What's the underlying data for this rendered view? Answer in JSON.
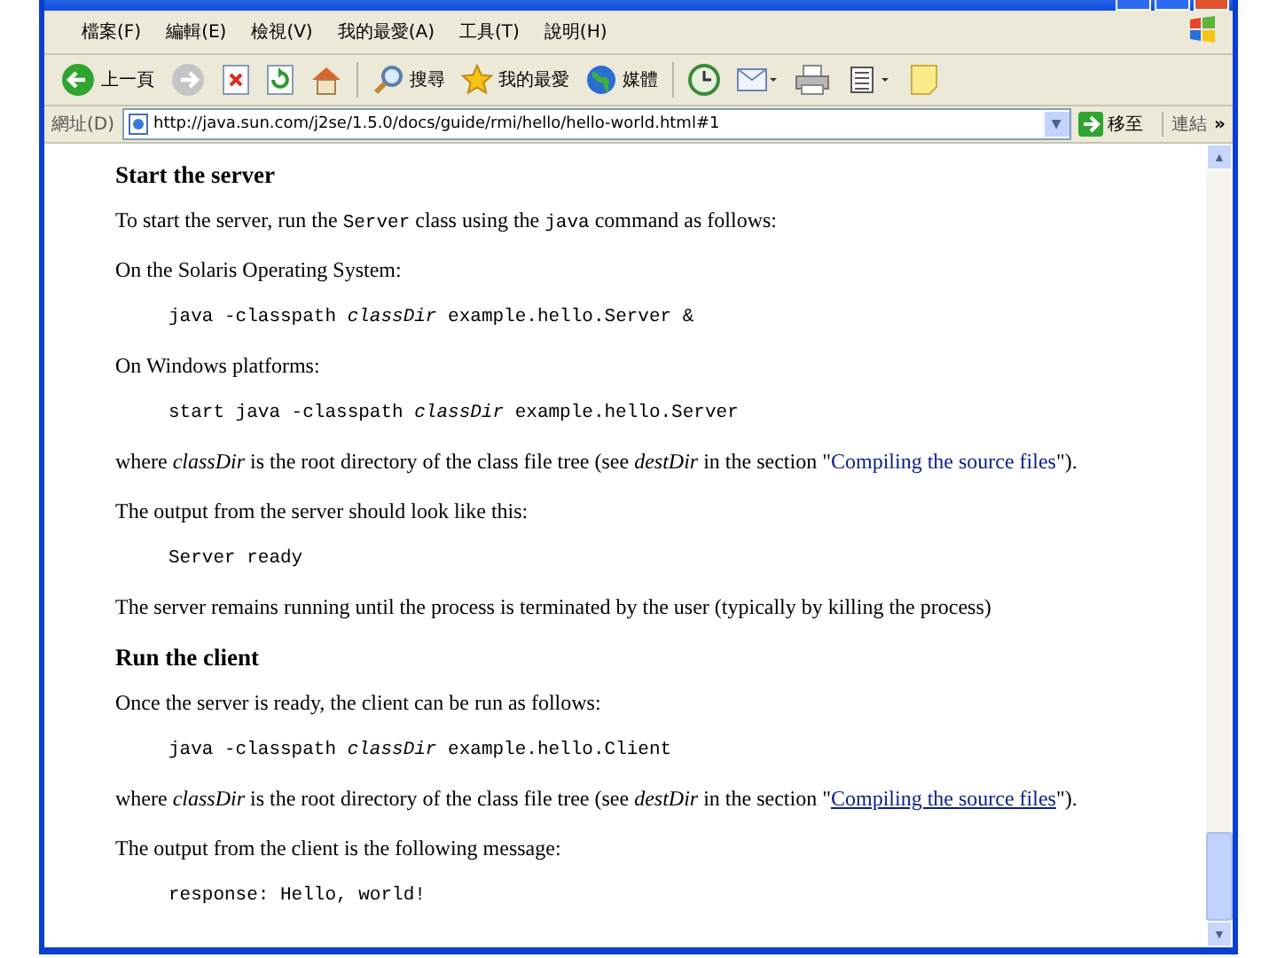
{
  "menu": [
    "檔案(F)",
    "編輯(E)",
    "檢視(V)",
    "我的最愛(A)",
    "工具(T)",
    "說明(H)"
  ],
  "toolbar": [
    {
      "kind": "back",
      "label": "上一頁"
    },
    {
      "kind": "forward"
    },
    {
      "kind": "stop"
    },
    {
      "kind": "refresh"
    },
    {
      "kind": "home"
    },
    {
      "kind": "search",
      "label": "搜尋"
    },
    {
      "kind": "favorites",
      "label": "我的最愛"
    },
    {
      "kind": "media",
      "label": "媒體"
    },
    {
      "kind": "history"
    },
    {
      "kind": "mail"
    },
    {
      "kind": "print"
    },
    {
      "kind": "edit"
    },
    {
      "kind": "note"
    }
  ],
  "address": {
    "label": "網址(D)",
    "url": "http://java.sun.com/j2se/1.5.0/docs/guide/rmi/hello/hello-world.html#1",
    "go": "移至",
    "links": "連結",
    "more": "»",
    "dropdown": "▼"
  },
  "content": [
    {
      "kind": "heading",
      "text": "Start the server"
    },
    {
      "kind": "mixed_para",
      "parts": [
        {
          "kind": "plain",
          "text": "To start the server, run the "
        },
        {
          "kind": "code",
          "text": "Server"
        },
        {
          "kind": "plain",
          "text": " class using the "
        },
        {
          "kind": "code",
          "text": "java"
        },
        {
          "kind": "plain",
          "text": " command as follows:"
        }
      ]
    },
    {
      "kind": "para",
      "text": "On the Solaris Operating System:"
    },
    {
      "kind": "code",
      "text": "java -classpath *classDir* example.hello.Server &"
    },
    {
      "kind": "para",
      "text": "On Windows platforms:"
    },
    {
      "kind": "code",
      "text": "start java -classpath *classDir* example.hello.Server"
    },
    {
      "kind": "link_para",
      "before": "where *classDir* is the root directory of the class file tree (see *destDir* in the section \"",
      "link": "Compiling the source files",
      "after": "\").",
      "visited": false
    },
    {
      "kind": "para",
      "text": "The output from the server should look like this:"
    },
    {
      "kind": "code",
      "text": "Server ready"
    },
    {
      "kind": "para",
      "text": "The server remains running until the process is terminated by the user (typically by killing the process)"
    },
    {
      "kind": "heading",
      "text": "Run the client"
    },
    {
      "kind": "para",
      "text": "Once the server is ready, the client can be run as follows:"
    },
    {
      "kind": "code",
      "text": "java -classpath *classDir* example.hello.Client"
    },
    {
      "kind": "link_para",
      "before": "where *classDir* is the root directory of the class file tree (see *destDir* in the section \"",
      "link": "Compiling the source files",
      "after": "\").",
      "visited": true
    },
    {
      "kind": "para",
      "text": "The output from the client is the following message:"
    },
    {
      "kind": "code",
      "text": "response: Hello, world!"
    }
  ],
  "scrollbar": {
    "up": "▲",
    "down": "▼"
  }
}
